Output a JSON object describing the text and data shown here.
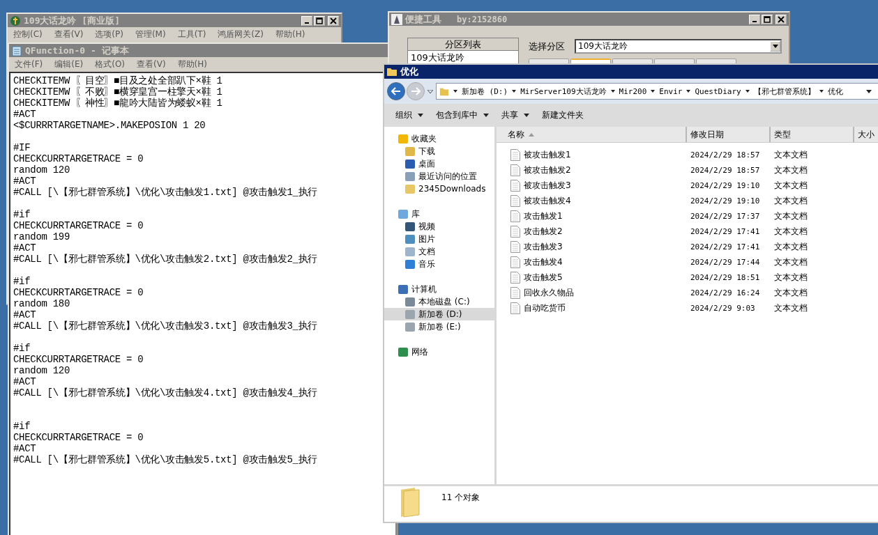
{
  "main_window": {
    "title": "109大话龙吟 [商业版]",
    "menu": [
      "控制(C)",
      "查看(V)",
      "选项(P)",
      "管理(M)",
      "工具(T)",
      "鸿盾网关(Z)",
      "帮助(H)"
    ]
  },
  "notepad": {
    "title": "QFunction-0 - 记事本",
    "menu": [
      "文件(F)",
      "编辑(E)",
      "格式(O)",
      "查看(V)",
      "帮助(H)"
    ],
    "blocks": [
      {
        "gap_after": false,
        "lines": [
          "CHECKITEMW 〖目空〗■目及之处全部趴下×鞋 1",
          "CHECKITEMW 〖不败〗■横穿皇宫一柱擎天×鞋 1",
          "CHECKITEMW 〖神性〗■龍吟大陆皆为蝼蚁×鞋 1",
          "#ACT",
          "<$CURRRTARGETNAME>.MAKEPOSION 1 20"
        ]
      },
      {
        "gap_after": false,
        "lines": [
          "#IF",
          "CHECKCURRTARGETRACE = 0",
          "random 120",
          "#ACT",
          "#CALL [\\【邪七群管系统】\\优化\\攻击触发1.txt] @攻击触发1_执行"
        ]
      },
      {
        "gap_after": false,
        "lines": [
          "#if",
          "CHECKCURRTARGETRACE = 0",
          "random 199",
          "#ACT",
          "#CALL [\\【邪七群管系统】\\优化\\攻击触发2.txt] @攻击触发2_执行"
        ]
      },
      {
        "gap_after": false,
        "lines": [
          "#if",
          "CHECKCURRTARGETRACE = 0",
          "random 180",
          "#ACT",
          "#CALL [\\【邪七群管系统】\\优化\\攻击触发3.txt] @攻击触发3_执行"
        ]
      },
      {
        "gap_after": true,
        "lines": [
          "#if",
          "CHECKCURRTARGETRACE = 0",
          "random 120",
          "#ACT",
          "#CALL [\\【邪七群管系统】\\优化\\攻击触发4.txt] @攻击触发4_执行"
        ]
      },
      {
        "gap_after": false,
        "lines": [
          "#if",
          "CHECKCURRTARGETRACE = 0",
          "#ACT",
          "#CALL [\\【邪七群管系统】\\优化\\攻击触发5.txt] @攻击触发5_执行"
        ]
      }
    ]
  },
  "tool_window": {
    "title": "便捷工具",
    "author": "by:2152860",
    "list_header": "分区列表",
    "list_items": [
      "109大话龙吟"
    ],
    "select_label": "选择分区",
    "select_value": "109大话龙吟",
    "tabs": [
      {
        "selected": false
      },
      {
        "selected": true
      },
      {
        "selected": false
      },
      {
        "selected": false
      },
      {
        "selected": false
      }
    ]
  },
  "explorer": {
    "title": "优化",
    "path": [
      "新加卷 (D:)",
      "MirServer109大话龙吟",
      "Mir200",
      "Envir",
      "QuestDiary",
      "【邪七群管系统】",
      "优化"
    ],
    "toolbar": [
      {
        "label": "组织",
        "dropdown": true
      },
      {
        "label": "包含到库中",
        "dropdown": true
      },
      {
        "label": "共享",
        "dropdown": true
      },
      {
        "label": "新建文件夹",
        "dropdown": false
      }
    ],
    "sidebar": [
      {
        "label": "收藏夹",
        "kind": "star",
        "children": [
          {
            "label": "下载",
            "kind": "download",
            "selected": false
          },
          {
            "label": "桌面",
            "kind": "desktop",
            "selected": false
          },
          {
            "label": "最近访问的位置",
            "kind": "recent",
            "selected": false
          },
          {
            "label": "2345Downloads",
            "kind": "folder",
            "selected": false
          }
        ]
      },
      {
        "label": "库",
        "kind": "library",
        "children": [
          {
            "label": "视频",
            "kind": "video",
            "selected": false
          },
          {
            "label": "图片",
            "kind": "image",
            "selected": false
          },
          {
            "label": "文档",
            "kind": "document",
            "selected": false
          },
          {
            "label": "音乐",
            "kind": "music",
            "selected": false
          }
        ]
      },
      {
        "label": "计算机",
        "kind": "computer",
        "children": [
          {
            "label": "本地磁盘 (C:)",
            "kind": "system-drive",
            "selected": false
          },
          {
            "label": "新加卷 (D:)",
            "kind": "drive",
            "selected": true
          },
          {
            "label": "新加卷 (E:)",
            "kind": "drive",
            "selected": false
          }
        ]
      },
      {
        "label": "网络",
        "kind": "network"
      }
    ],
    "columns": [
      "名称",
      "修改日期",
      "类型",
      "大小"
    ],
    "files": [
      {
        "name": "被攻击触发1",
        "modified": "2024/2/29 18:57",
        "type": "文本文档"
      },
      {
        "name": "被攻击触发2",
        "modified": "2024/2/29 18:57",
        "type": "文本文档"
      },
      {
        "name": "被攻击触发3",
        "modified": "2024/2/29 19:10",
        "type": "文本文档"
      },
      {
        "name": "被攻击触发4",
        "modified": "2024/2/29 19:10",
        "type": "文本文档"
      },
      {
        "name": "攻击触发1",
        "modified": "2024/2/29 17:37",
        "type": "文本文档"
      },
      {
        "name": "攻击触发2",
        "modified": "2024/2/29 17:41",
        "type": "文本文档"
      },
      {
        "name": "攻击触发3",
        "modified": "2024/2/29 17:41",
        "type": "文本文档"
      },
      {
        "name": "攻击触发4",
        "modified": "2024/2/29 17:44",
        "type": "文本文档"
      },
      {
        "name": "攻击触发5",
        "modified": "2024/2/29 18:51",
        "type": "文本文档"
      },
      {
        "name": "回收永久物品",
        "modified": "2024/2/29 16:24",
        "type": "文本文档"
      },
      {
        "name": "自动吃货币",
        "modified": "2024/2/29 9:03",
        "type": "文本文档"
      }
    ],
    "status": "11 个对象"
  }
}
